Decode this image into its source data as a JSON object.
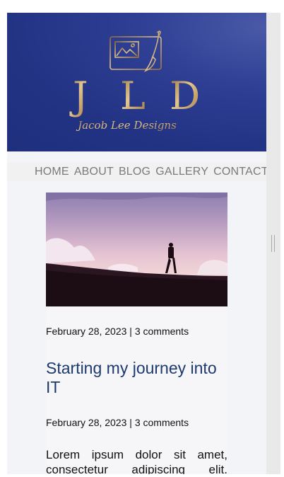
{
  "brand": {
    "initials": [
      "J",
      "L",
      "D"
    ],
    "tagline": "Jacob Lee Designs"
  },
  "nav": {
    "items": [
      "HOME",
      "ABOUT",
      "BLOG",
      "GALLERY",
      "CONTACT"
    ]
  },
  "post": {
    "meta_top": "February 28, 2023 | 3 comments",
    "title": "Starting my journey into IT",
    "meta_bottom": "February 28, 2023 | 3 comments",
    "excerpt": "Lorem ipsum dolor sit amet, consectetur adipiscing elit."
  },
  "colors": {
    "header_blue": "#223384",
    "gold": "#c9a56a",
    "title_blue": "#1d3a6e",
    "nav_text": "#7a7a7a"
  }
}
